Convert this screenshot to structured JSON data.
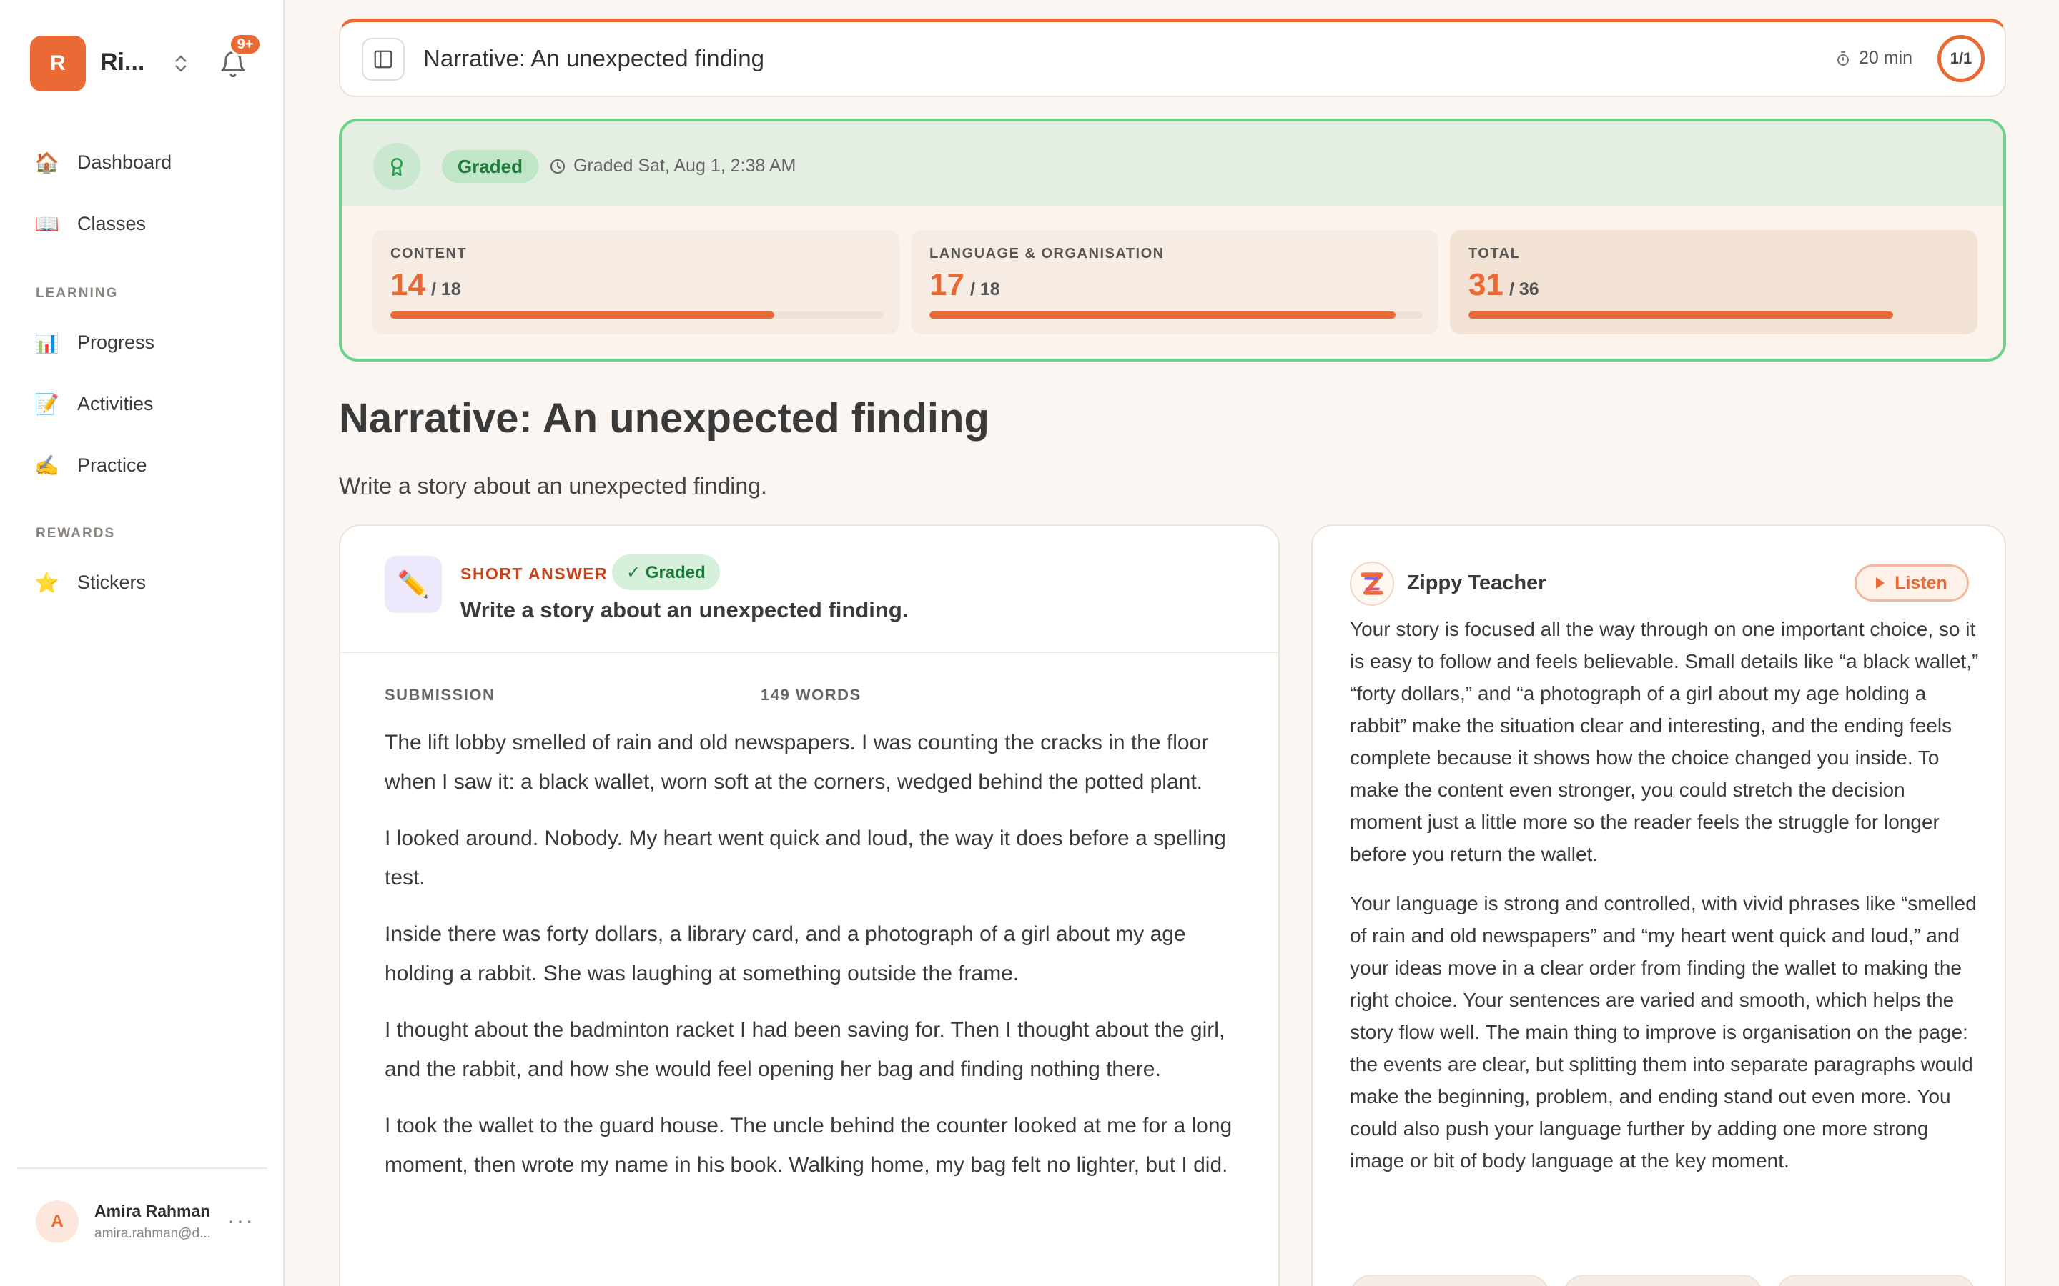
{
  "brand": {
    "initial": "R",
    "name": "Ri...",
    "notifications": "9+"
  },
  "nav": {
    "main": [
      {
        "icon": "🏠",
        "label": "Dashboard"
      },
      {
        "icon": "📖",
        "label": "Classes"
      }
    ],
    "learning_header": "LEARNING",
    "learning": [
      {
        "icon": "📊",
        "label": "Progress"
      },
      {
        "icon": "📝",
        "label": "Activities"
      },
      {
        "icon": "✍️",
        "label": "Practice"
      }
    ],
    "rewards_header": "REWARDS",
    "rewards": [
      {
        "icon": "⭐",
        "label": "Stickers"
      }
    ]
  },
  "user": {
    "initial": "A",
    "name": "Amira Rahman",
    "email": "amira.rahman@d...",
    "more": "···"
  },
  "topbar": {
    "title": "Narrative: An unexpected finding",
    "timer": "20 min",
    "progress": "1/1"
  },
  "grade": {
    "status": "Graded",
    "date": "Graded Sat, Aug 1, 2:38 AM",
    "scores": [
      {
        "label": "CONTENT",
        "score": "14",
        "max": "/ 18",
        "fraction": 0.7778
      },
      {
        "label": "LANGUAGE & ORGANISATION",
        "score": "17",
        "max": "/ 18",
        "fraction": 0.9444
      },
      {
        "label": "TOTAL",
        "score": "31",
        "max": "/ 36",
        "fraction": 0.8611
      }
    ]
  },
  "assignment": {
    "title": "Narrative: An unexpected finding",
    "description": "Write a story about an unexpected finding."
  },
  "question": {
    "icon": "✏️",
    "type": "SHORT ANSWER",
    "status": "✓ Graded",
    "prompt": "Write a story about an unexpected finding.",
    "submission_label": "SUBMISSION",
    "word_count": "149 WORDS",
    "paragraphs": [
      "The lift lobby smelled of rain and old newspapers. I was counting the cracks in the floor when I saw it: a black wallet, worn soft at the corners, wedged behind the potted plant.",
      "I looked around. Nobody. My heart went quick and loud, the way it does before a spelling test.",
      "Inside there was forty dollars, a library card, and a photograph of a girl about my age holding a rabbit. She was laughing at something outside the frame.",
      "I thought about the badminton racket I had been saving for. Then I thought about the girl, and the rabbit, and how she would feel opening her bag and finding nothing there.",
      "I took the wallet to the guard house. The uncle behind the counter looked at me for a long moment, then wrote my name in his book. Walking home, my bag felt no lighter, but I did."
    ]
  },
  "feedback": {
    "name": "Zippy Teacher",
    "listen": "Listen",
    "paragraphs": [
      "Your story is focused all the way through on one important choice, so it is easy to follow and feels believable. Small details like “a black wallet,” “forty dollars,” and “a photograph of a girl about my age holding a rabbit” make the situation clear and interesting, and the ending feels complete because it shows how the choice changed you inside. To make the content even stronger, you could stretch the decision moment just a little more so the reader feels the struggle for longer before you return the wallet.",
      "Your language is strong and controlled, with vivid phrases like “smelled of rain and old newspapers” and “my heart went quick and loud,” and your ideas move in a clear order from finding the wallet to making the right choice. Your sentences are varied and smooth, which helps the story flow well. The main thing to improve is organisation on the page: the events are clear, but splitting them into separate paragraphs would make the beginning, problem, and ending stand out even more. You could also push your language further by adding one more strong image or bit of body language at the key moment."
    ]
  },
  "colors": {
    "accent": "#ea6a35",
    "success": "#6fd08a",
    "background": "#fbf6f1"
  }
}
